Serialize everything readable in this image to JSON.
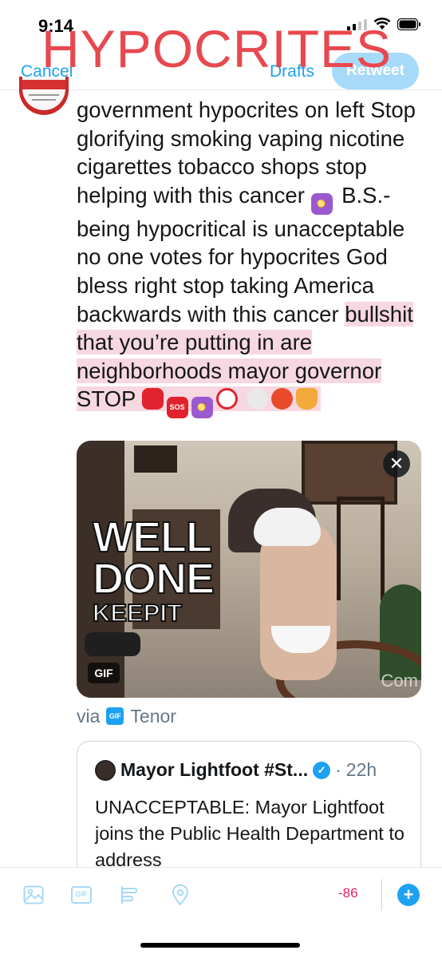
{
  "status_bar": {
    "time": "9:14"
  },
  "overlay": {
    "title": "HYPOCRITES"
  },
  "header": {
    "cancel_label": "Cancel",
    "drafts_label": "Drafts",
    "retweet_label": "Retweet"
  },
  "tweet": {
    "text_plain": "government hypocrites on left Stop glorifying smoking vaping nicotine cigarettes tobacco shops stop helping with this cancer",
    "text_plain_2": "B.S.-being hypocritical is unacceptable no one votes for hypocrites God bless right stop taking America backwards with this cancer",
    "text_highlighted": "bullshit that you’re putting in are neighborhoods mayor governor STOP",
    "emojis": [
      "cancer-sign",
      "stop-sign",
      "sos-button",
      "cancer-sign",
      "no-smoking",
      "skull",
      "angry-face",
      "thumbs-down"
    ]
  },
  "media": {
    "caption_line_1": "WELL",
    "caption_line_2": "DONE",
    "caption_line_3": "KEEPIT",
    "watermark": "Com",
    "badge": "GIF",
    "close_glyph": "✕",
    "via_label": "via",
    "provider_logo": "GIF",
    "provider": "Tenor"
  },
  "quote": {
    "name": "Mayor Lightfoot #St...",
    "separator": "·",
    "time": "22h",
    "text": "UNACCEPTABLE: Mayor Lightfoot joins the Public Health Department to address"
  },
  "toolbar": {
    "gif_label": "GIF",
    "char_count": "-86",
    "add_glyph": "+"
  },
  "colors": {
    "accent": "#1da1f2",
    "overlay_red": "#e8484f",
    "highlight": "#f7d7e0",
    "count_red": "#e0245e"
  }
}
